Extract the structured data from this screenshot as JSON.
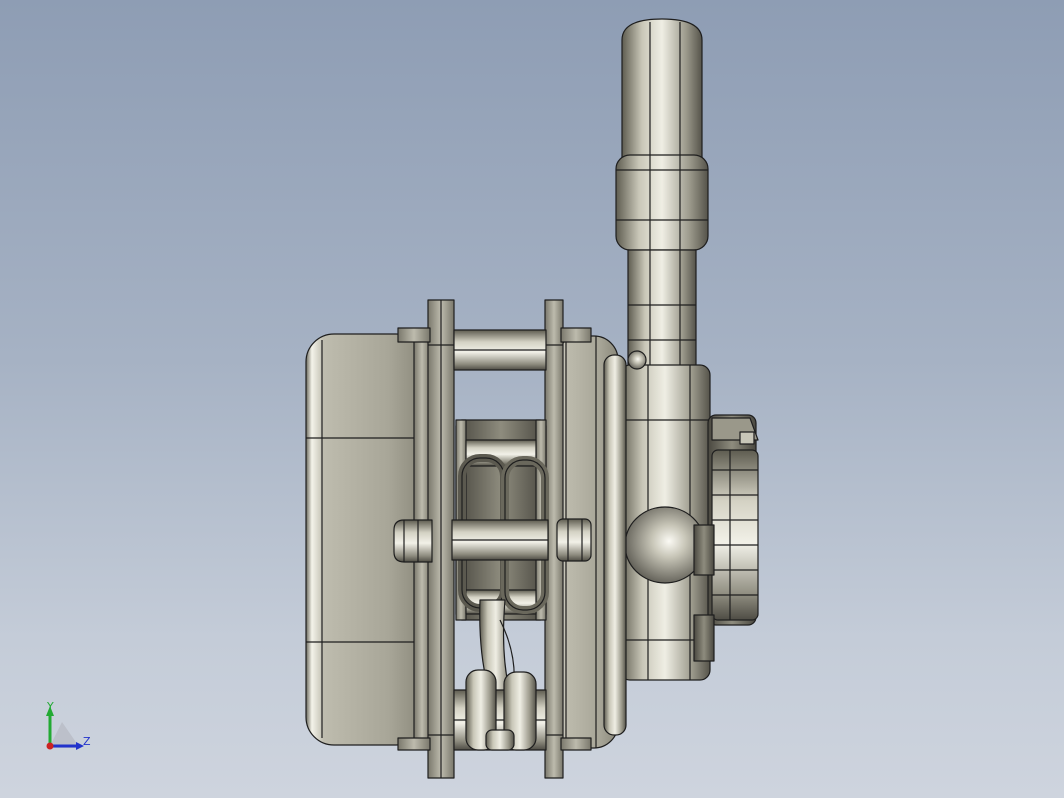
{
  "viewport": {
    "background_top": "#8e9db4",
    "background_bottom": "#ced4de"
  },
  "model": {
    "description_icon": "winch-hoist-side-view",
    "metal_color": "#b0aea0",
    "edge_color": "#1e1e1e"
  },
  "triad": {
    "y_label": "Y",
    "z_label": "Z",
    "y_color": "#22aa33",
    "z_color": "#2233cc",
    "x_color": "#cc2222"
  }
}
